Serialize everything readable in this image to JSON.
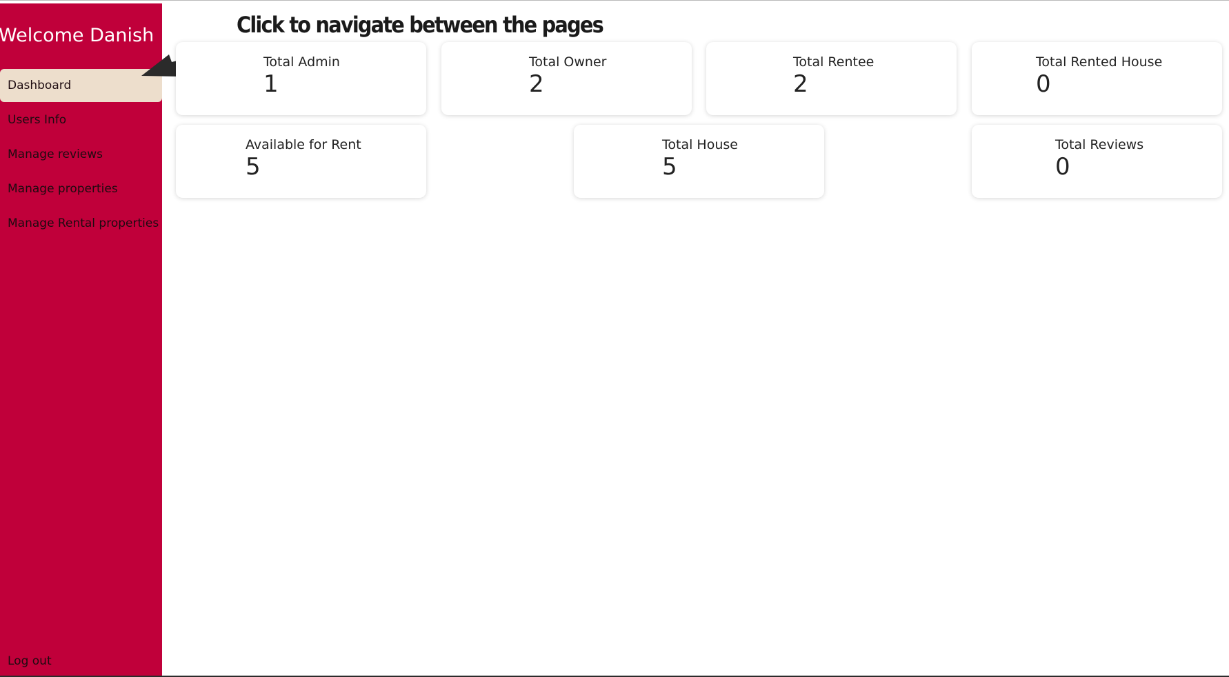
{
  "sidebar": {
    "title": "Welcome Danish",
    "items": [
      {
        "label": "Dashboard"
      },
      {
        "label": "Users Info"
      },
      {
        "label": "Manage reviews"
      },
      {
        "label": "Manage properties"
      },
      {
        "label": "Manage Rental properties"
      }
    ],
    "logout_label": "Log out",
    "background_color": "#c0003a",
    "active_item_color": "#eddecc"
  },
  "annotation": {
    "text": "Click to navigate between the pages",
    "pointer_icon": "arrow-pointer-icon"
  },
  "stats": [
    {
      "label": "Total Admin",
      "value": "1"
    },
    {
      "label": "Total Owner",
      "value": "2"
    },
    {
      "label": "Total Rentee",
      "value": "2"
    },
    {
      "label": "Total Rented House",
      "value": "0"
    },
    {
      "label": "Available for Rent",
      "value": "5"
    },
    {
      "label": "Total House",
      "value": "5"
    },
    {
      "label": "Total Reviews",
      "value": "0"
    }
  ]
}
